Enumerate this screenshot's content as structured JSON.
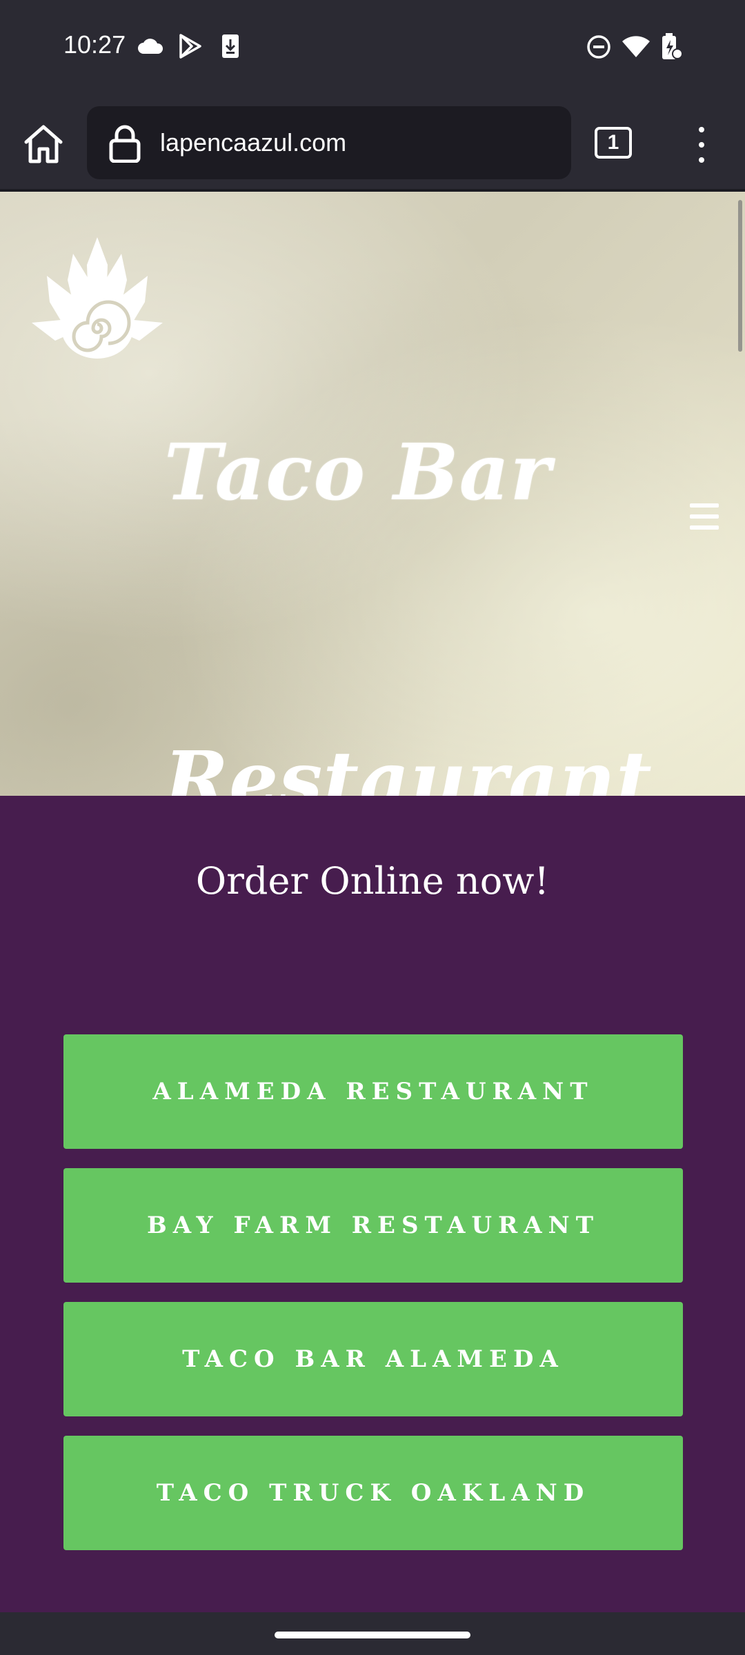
{
  "status_bar": {
    "time": "10:27",
    "icons_left": [
      "cloud-icon",
      "play-store-icon",
      "download-icon"
    ],
    "icons_right": [
      "do-not-disturb-icon",
      "wifi-icon",
      "battery-charging-icon"
    ]
  },
  "browser": {
    "url": "lapencaazul.com",
    "tab_count": "1"
  },
  "hero": {
    "title": "Taco Bar",
    "subtitle": "Restaurant"
  },
  "order": {
    "heading": "Order Online now!",
    "buttons": [
      {
        "label": "ALAMEDA RESTAURANT"
      },
      {
        "label": "BAY FARM RESTAURANT"
      },
      {
        "label": "TACO BAR ALAMEDA"
      },
      {
        "label": "TACO TRUCK OAKLAND"
      }
    ]
  },
  "colors": {
    "section_bg": "#471d4e",
    "button_bg": "#66c661",
    "browser_chrome": "#2b2a33"
  }
}
